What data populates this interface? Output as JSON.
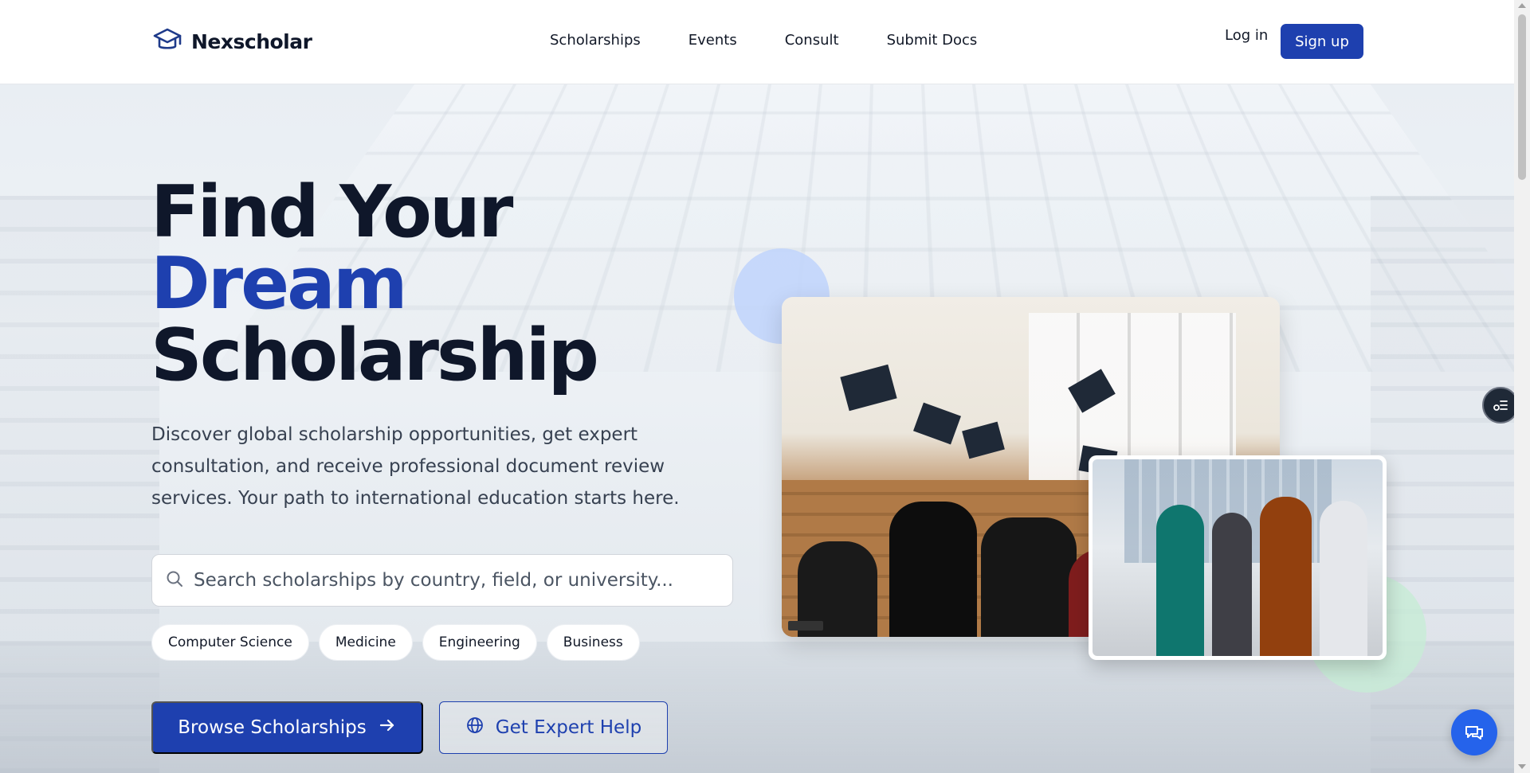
{
  "brand": {
    "name": "Nexscholar",
    "logo_icon": "graduation-cap-icon",
    "accent": "#1e40af"
  },
  "nav": {
    "items": [
      {
        "label": "Scholarships"
      },
      {
        "label": "Events"
      },
      {
        "label": "Consult"
      },
      {
        "label": "Submit Docs"
      }
    ],
    "login_label": "Log in",
    "signup_label": "Sign up"
  },
  "hero": {
    "title_line1": "Find Your",
    "title_accent": "Dream",
    "title_line3": "Scholarship",
    "description": "Discover global scholarship opportunities, get expert consultation, and receive professional document review services. Your path to international education starts here.",
    "search": {
      "placeholder": "Search scholarships by country, field, or university...",
      "value": "",
      "icon": "search-icon"
    },
    "chips": [
      "Computer Science",
      "Medicine",
      "Engineering",
      "Business"
    ],
    "primary_cta": {
      "label": "Browse Scholarships",
      "icon": "arrow-right-icon"
    },
    "secondary_cta": {
      "label": "Get Expert Help",
      "icon": "globe-icon"
    }
  },
  "widgets": {
    "side_tab_icon": "list-settings-icon",
    "chat_icon": "chat-bubbles-icon",
    "chat_color": "#2563eb"
  }
}
